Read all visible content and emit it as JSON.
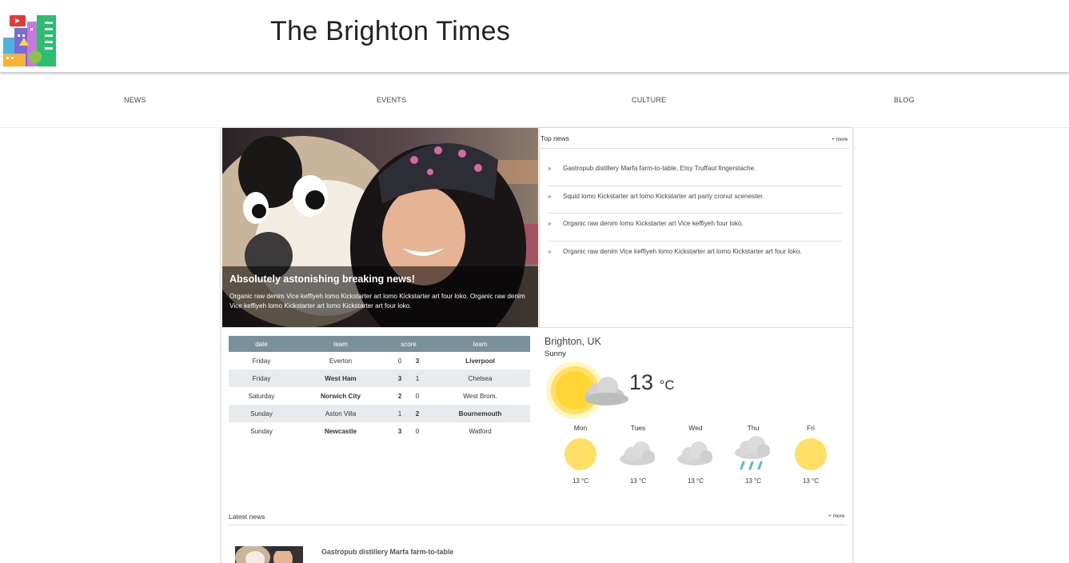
{
  "site": {
    "title": "The Brighton Times"
  },
  "nav": {
    "items": [
      "NEWS",
      "EVENTS",
      "CULTURE",
      "BLOG"
    ]
  },
  "hero": {
    "title": "Absolutely astonishing breaking news!",
    "text": "Organic raw denim Vice keffiyeh lomo Kickstarter art lomo Kickstarter art four loko. Organic raw denim Vice keffiyeh lomo Kickstarter art lomo Kickstarter art four loko."
  },
  "top_news": {
    "heading": "Top news",
    "more": "+ more",
    "bullet": "»",
    "items": [
      "Gastropub distillery Marfa farm-to-table, Etsy Truffaut fingerstache.",
      "Squid lomo Kickstarter art lomo Kickstarter art party cronut scenester.",
      "Organic raw denim lomo Kickstarter art Vice keffiyeh four loko.",
      "Organic raw denim Vice keffiyeh lomo Kickstarter art lomo Kickstarter art four loko."
    ]
  },
  "scores": {
    "headers": [
      "date",
      "team",
      "score",
      "team"
    ],
    "rows": [
      {
        "date": "Friday",
        "home": "Everton",
        "hs": "0",
        "as": "3",
        "away": "Liverpool",
        "winner": "away"
      },
      {
        "date": "Friday",
        "home": "West Ham",
        "hs": "3",
        "as": "1",
        "away": "Chelsea",
        "winner": "home"
      },
      {
        "date": "Saturday",
        "home": "Norwich City",
        "hs": "2",
        "as": "0",
        "away": "West Brom.",
        "winner": "home"
      },
      {
        "date": "Sunday",
        "home": "Aston Villa",
        "hs": "1",
        "as": "2",
        "away": "Bournemouth",
        "winner": "away"
      },
      {
        "date": "Sunday",
        "home": "Newcastle",
        "hs": "3",
        "as": "0",
        "away": "Watford",
        "winner": "home"
      }
    ]
  },
  "weather": {
    "city": "Brighton, UK",
    "condition": "Sunny",
    "temp": "13",
    "unit": "°C",
    "current_icon": "sun-cloud-icon",
    "forecast": [
      {
        "day": "Mon",
        "icon": "sun-icon",
        "temp": "13 °C"
      },
      {
        "day": "Tues",
        "icon": "cloud-icon",
        "temp": "13 °C"
      },
      {
        "day": "Wed",
        "icon": "cloud-icon",
        "temp": "13 °C"
      },
      {
        "day": "Thu",
        "icon": "rain-icon",
        "temp": "13 °C"
      },
      {
        "day": "Fri",
        "icon": "sun-icon",
        "temp": "13 °C"
      }
    ]
  },
  "latest_news": {
    "heading": "Latest news",
    "more": "+ more",
    "items": [
      {
        "title": "Gastropub distillery Marfa farm-to-table"
      }
    ]
  },
  "colors": {
    "table_header": "#7a9199",
    "table_alt_row": "#e7ebed",
    "sun": "#ffe066",
    "rain": "#5bb8d6"
  }
}
